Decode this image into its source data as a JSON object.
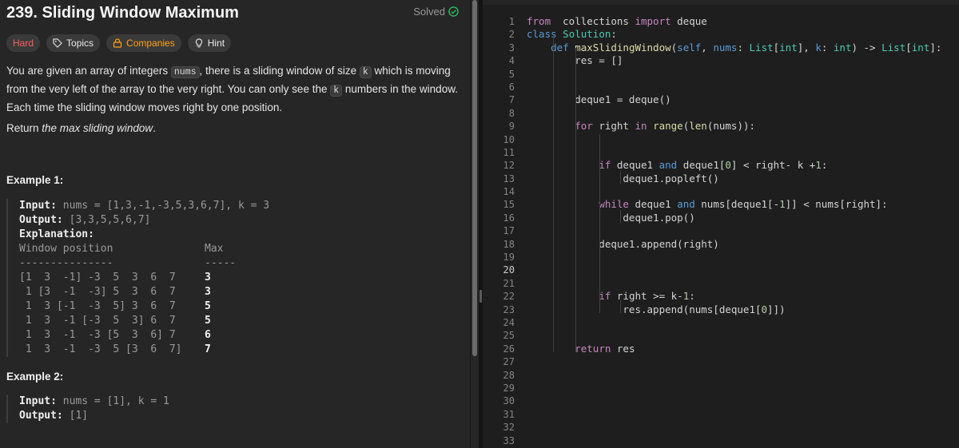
{
  "problem": {
    "title": "239. Sliding Window Maximum",
    "solved_label": "Solved",
    "tags": {
      "difficulty": "Hard",
      "topics": "Topics",
      "companies": "Companies",
      "hint": "Hint"
    },
    "desc_p1": "You are given an array of integers ",
    "desc_code1": "nums",
    "desc_p2": ", there is a sliding window of size ",
    "desc_code2": "k",
    "desc_p3": " which is moving from the very left of the array to the very right. You can only see the ",
    "desc_code3": "k",
    "desc_p4": " numbers in the window. Each time the sliding window moves right by one position.",
    "return_prefix": "Return ",
    "return_em": "the max sliding window",
    "return_suffix": ".",
    "example1": {
      "title": "Example 1:",
      "input_label": "Input:",
      "input_val": " nums = [1,3,-1,-3,5,3,6,7], k = 3",
      "output_label": "Output:",
      "output_val": " [3,3,5,5,6,7]",
      "explanation_label": "Explanation:",
      "header_window": "Window position",
      "header_max": "Max",
      "sep_window": "---------------",
      "sep_max": "-----",
      "rows": [
        {
          "window": "[1  3  -1] -3  5  3  6  7",
          "max": "3"
        },
        {
          "window": " 1 [3  -1  -3] 5  3  6  7",
          "max": "3"
        },
        {
          "window": " 1  3 [-1  -3  5] 3  6  7",
          "max": "5"
        },
        {
          "window": " 1  3  -1 [-3  5  3] 6  7",
          "max": "5"
        },
        {
          "window": " 1  3  -1  -3 [5  3  6] 7",
          "max": "6"
        },
        {
          "window": " 1  3  -1  -3  5 [3  6  7]",
          "max": "7"
        }
      ]
    },
    "example2": {
      "title": "Example 2:",
      "input_label": "Input:",
      "input_val": " nums = [1], k = 1",
      "output_label": "Output:",
      "output_val": " [1]"
    }
  },
  "editor": {
    "current_line": 20,
    "lines": [
      [
        [
          "k1",
          "from"
        ],
        [
          "",
          "  collections "
        ],
        [
          "k1",
          "import"
        ],
        [
          "",
          " deque"
        ]
      ],
      [
        [
          "k2",
          "class"
        ],
        [
          "",
          " "
        ],
        [
          "cls",
          "Solution"
        ],
        [
          "",
          ":"
        ]
      ],
      [
        [
          "",
          "    "
        ],
        [
          "k2",
          "def"
        ],
        [
          "",
          " "
        ],
        [
          "fn",
          "maxSlidingWindow"
        ],
        [
          "",
          "("
        ],
        [
          "k2",
          "self"
        ],
        [
          "",
          ", "
        ],
        [
          "k2",
          "nums"
        ],
        [
          "",
          ": "
        ],
        [
          "cls",
          "List"
        ],
        [
          "",
          "["
        ],
        [
          "cls",
          "int"
        ],
        [
          "",
          "], "
        ],
        [
          "k2",
          "k"
        ],
        [
          "",
          ": "
        ],
        [
          "cls",
          "int"
        ],
        [
          "",
          ") -> "
        ],
        [
          "cls",
          "List"
        ],
        [
          "",
          "["
        ],
        [
          "cls",
          "int"
        ],
        [
          "",
          "]:"
        ]
      ],
      [
        [
          "",
          "        res = []"
        ]
      ],
      [],
      [],
      [
        [
          "",
          "        deque1 = deque()"
        ]
      ],
      [],
      [
        [
          "",
          "        "
        ],
        [
          "k1",
          "for"
        ],
        [
          "",
          " right "
        ],
        [
          "k1",
          "in"
        ],
        [
          "",
          " "
        ],
        [
          "fn",
          "range"
        ],
        [
          "",
          "("
        ],
        [
          "fn",
          "len"
        ],
        [
          "",
          "(nums)):"
        ]
      ],
      [],
      [],
      [
        [
          "",
          "            "
        ],
        [
          "k1",
          "if"
        ],
        [
          "",
          " deque1 "
        ],
        [
          "k2",
          "and"
        ],
        [
          "",
          " deque1["
        ],
        [
          "num",
          "0"
        ],
        [
          "",
          "] < right- k +"
        ],
        [
          "num",
          "1"
        ],
        [
          "",
          ":"
        ]
      ],
      [
        [
          "",
          "                deque1.popleft()"
        ]
      ],
      [],
      [
        [
          "",
          "            "
        ],
        [
          "k1",
          "while"
        ],
        [
          "",
          " deque1 "
        ],
        [
          "k2",
          "and"
        ],
        [
          "",
          " nums[deque1[-"
        ],
        [
          "num",
          "1"
        ],
        [
          "",
          "]] < nums[right]:"
        ]
      ],
      [
        [
          "",
          "                deque1.pop()"
        ]
      ],
      [],
      [
        [
          "",
          "            deque1.append(right)"
        ]
      ],
      [],
      [],
      [],
      [
        [
          "",
          "            "
        ],
        [
          "k1",
          "if"
        ],
        [
          "",
          " right >= k-"
        ],
        [
          "num",
          "1"
        ],
        [
          "",
          ":"
        ]
      ],
      [
        [
          "",
          "                res.append(nums[deque1["
        ],
        [
          "num",
          "0"
        ],
        [
          "",
          "]])"
        ]
      ],
      [],
      [],
      [
        [
          "",
          "        "
        ],
        [
          "k1",
          "return"
        ],
        [
          "",
          " res"
        ]
      ],
      [],
      [],
      [],
      [],
      [],
      [],
      []
    ]
  }
}
